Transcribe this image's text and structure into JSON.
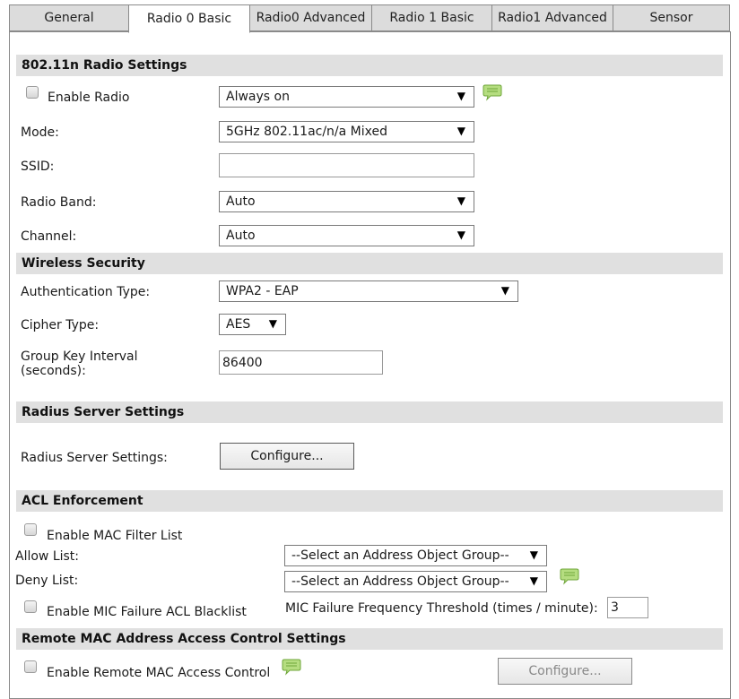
{
  "tabs": [
    {
      "label": "General"
    },
    {
      "label": "Radio 0 Basic"
    },
    {
      "label": "Radio0 Advanced"
    },
    {
      "label": "Radio 1 Basic"
    },
    {
      "label": "Radio1 Advanced"
    },
    {
      "label": "Sensor"
    }
  ],
  "active_tab": "Radio 0 Basic",
  "radio_settings": {
    "title": "802.11n Radio Settings",
    "enable_radio_label": "Enable Radio",
    "schedule_value": "Always on",
    "mode_label": "Mode:",
    "mode_value": "5GHz 802.11ac/n/a Mixed",
    "ssid_label": "SSID:",
    "ssid_value": "",
    "band_label": "Radio Band:",
    "band_value": "Auto",
    "channel_label": "Channel:",
    "channel_value": "Auto"
  },
  "wireless_security": {
    "title": "Wireless Security",
    "auth_label": "Authentication Type:",
    "auth_value": "WPA2 - EAP",
    "cipher_label": "Cipher Type:",
    "cipher_value": "AES",
    "gki_label_line1": "Group Key Interval",
    "gki_label_line2": "(seconds):",
    "gki_value": "86400"
  },
  "radius": {
    "title": "Radius Server Settings",
    "label": "Radius Server Settings:",
    "button": "Configure..."
  },
  "acl": {
    "title": "ACL Enforcement",
    "enable_mac_filter_label": "Enable MAC Filter List",
    "allow_label": "Allow List:",
    "allow_value": "--Select an Address Object Group--",
    "deny_label": "Deny List:",
    "deny_value": "--Select an Address Object Group--",
    "enable_mic_label": "Enable MIC Failure ACL Blacklist",
    "mic_threshold_label": "MIC Failure Frequency Threshold (times / minute):",
    "mic_threshold_value": "3"
  },
  "remote_mac": {
    "title": "Remote MAC Address Access Control Settings",
    "enable_label": "Enable Remote MAC Access Control",
    "button": "Configure..."
  },
  "arrow_glyph": "▼",
  "colors": {
    "section_bg": "#e0e0e0",
    "tab_bg": "#dcdcdc",
    "comment_icon": "#a8d870"
  }
}
